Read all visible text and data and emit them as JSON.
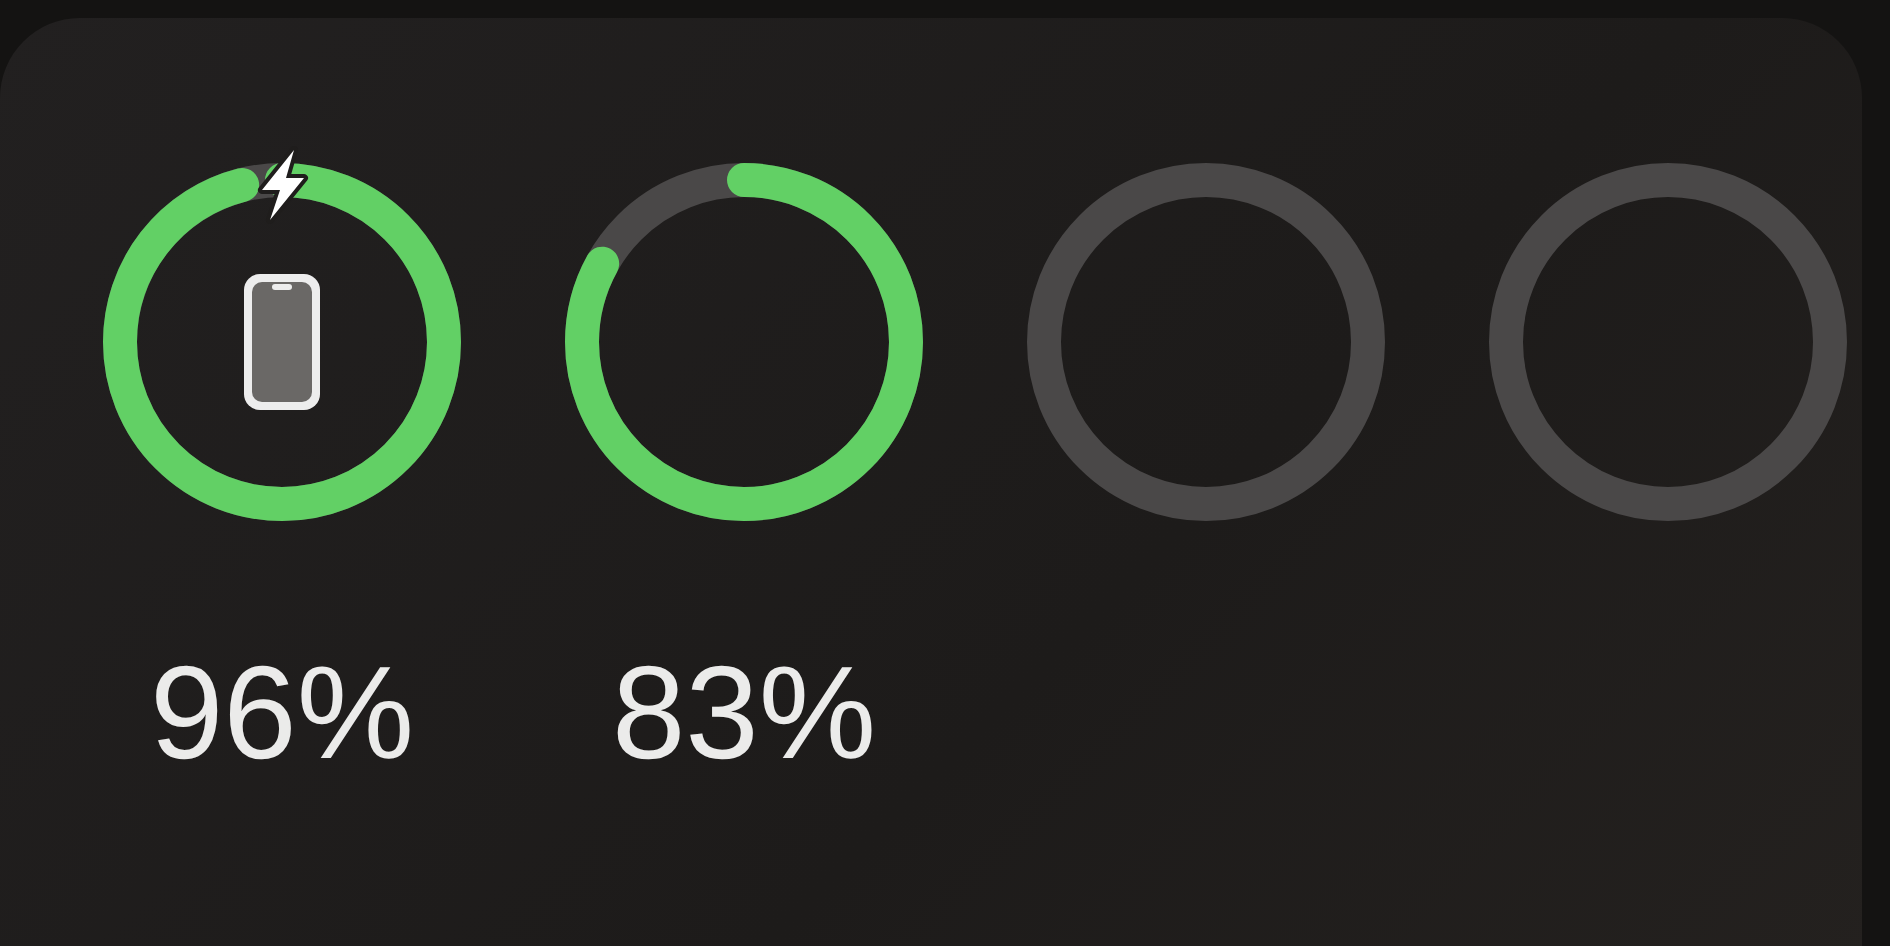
{
  "devices": [
    {
      "kind": "phone",
      "charging": true,
      "percent": "96%"
    },
    {
      "kind": "unknown",
      "charging": false,
      "percent": "83%"
    },
    {
      "kind": "empty"
    },
    {
      "kind": "empty"
    }
  ]
}
